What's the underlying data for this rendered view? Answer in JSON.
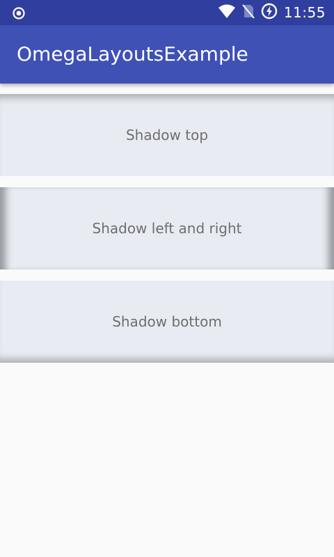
{
  "status_bar": {
    "time": "11:55",
    "icons": [
      "record-icon",
      "wifi-icon",
      "no-sim-icon",
      "battery-charging-icon"
    ]
  },
  "app_bar": {
    "title": "OmegaLayoutsExample"
  },
  "panels": [
    {
      "label": "Shadow top"
    },
    {
      "label": "Shadow left and right"
    },
    {
      "label": "Shadow bottom"
    }
  ],
  "colors": {
    "status_bar": "#303F9F",
    "app_bar": "#3F51B5",
    "panel": "#E8ECF2",
    "background": "#FAFAFA",
    "label": "#6E6E6E"
  }
}
